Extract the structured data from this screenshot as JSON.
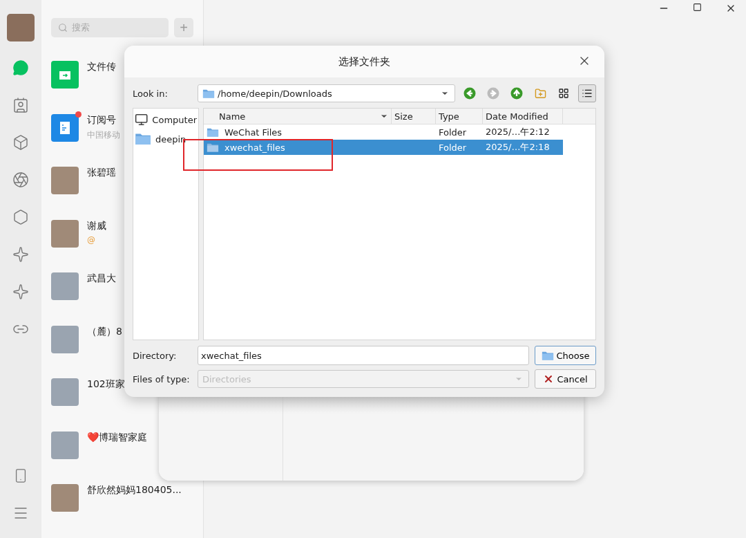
{
  "nav": [
    {
      "selected": true
    },
    {
      "selected": false
    },
    {
      "selected": false
    },
    {
      "selected": false
    },
    {
      "selected": false
    },
    {
      "selected": false
    },
    {
      "selected": false
    },
    {
      "selected": false
    }
  ],
  "search": {
    "placeholder": "搜索"
  },
  "add_button": "+",
  "chats": [
    {
      "name": "文件传",
      "kind": "file",
      "unread": false
    },
    {
      "name": "订阅号",
      "preview": "中国移动",
      "kind": "subscription",
      "unread": true
    },
    {
      "name": "张碧瑶",
      "kind": "photo",
      "unread": false
    },
    {
      "name": "谢威",
      "preview": "@",
      "kind": "photo",
      "unread": false
    },
    {
      "name": "武昌大",
      "kind": "group",
      "unread": false
    },
    {
      "name": "（麓）8",
      "kind": "group",
      "unread": false
    },
    {
      "name": "102班家",
      "kind": "group",
      "unread": false
    },
    {
      "name": "❤️博瑞智家庭",
      "kind": "group",
      "unread": false
    },
    {
      "name": "舒欣然妈妈180405...",
      "kind": "photo",
      "unread": false
    }
  ],
  "dialog": {
    "title": "选择文件夹",
    "look_in_label": "Look in:",
    "look_in_value": "/home/deepin/Downloads",
    "toolbar": [
      {
        "kind": "back",
        "disabled": false
      },
      {
        "kind": "forward",
        "disabled": true
      },
      {
        "kind": "up",
        "disabled": false
      },
      {
        "kind": "new_folder"
      },
      {
        "kind": "icon_view",
        "selected": false
      },
      {
        "kind": "detail_view",
        "selected": true
      }
    ],
    "places": [
      {
        "label": "Computer",
        "kind": "computer"
      },
      {
        "label": "deepin",
        "kind": "folder"
      }
    ],
    "columns": [
      "Name",
      "Size",
      "Type",
      "Date Modified"
    ],
    "rows": [
      {
        "name": "WeChat Files",
        "type": "Folder",
        "modified": "2025/…午2:12",
        "selected": false
      },
      {
        "name": "xwechat_files",
        "type": "Folder",
        "modified": "2025/…午2:18",
        "selected": true
      }
    ],
    "directory_label": "Directory:",
    "directory_value": "xwechat_files",
    "type_label": "Files of type:",
    "type_value": "Directories",
    "type_disabled": true,
    "buttons": [
      {
        "label": "Choose",
        "kind": "choose"
      },
      {
        "label": "Cancel",
        "kind": "cancel"
      }
    ]
  }
}
